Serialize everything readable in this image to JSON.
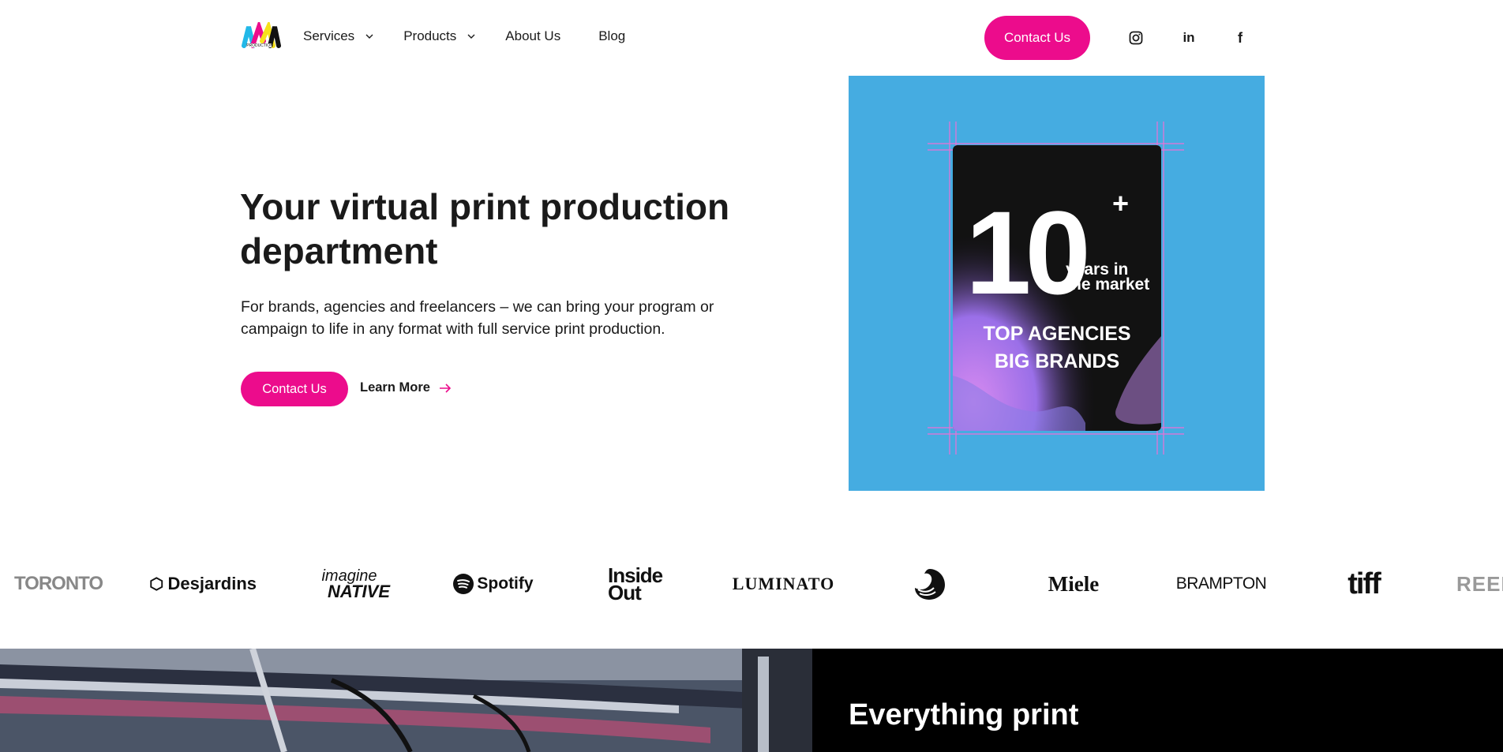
{
  "header": {
    "logo_alt": "M Production",
    "logo_caption": "PRODUCTION",
    "nav": [
      {
        "label": "Services",
        "has_dropdown": true
      },
      {
        "label": "Products",
        "has_dropdown": true
      },
      {
        "label": "About Us",
        "has_dropdown": false
      },
      {
        "label": "Blog",
        "has_dropdown": false
      }
    ],
    "cta_label": "Contact Us",
    "social": [
      {
        "icon": "instagram-icon"
      },
      {
        "icon": "linkedin-icon",
        "glyph": "in"
      },
      {
        "icon": "facebook-icon",
        "glyph": "f"
      }
    ]
  },
  "hero": {
    "title": "Your virtual print production department",
    "description": "For brands, agencies and freelancers – we can bring your program or campaign to life in any format with full service print production.",
    "primary_cta": "Contact Us",
    "secondary_cta": "Learn More"
  },
  "hero_visual": {
    "big_number": "10",
    "plus": "+",
    "years_text_line1": "years in",
    "years_text_line2": "the market",
    "tagline_line1": "TOP AGENCIES",
    "tagline_line2": "BIG BRANDS",
    "background_color": "#45ace1"
  },
  "brands": [
    {
      "name": "TORONTO"
    },
    {
      "name": "Desjardins"
    },
    {
      "name": "imagine",
      "line2": "NATIVE"
    },
    {
      "name": "Spotify"
    },
    {
      "name": "Inside",
      "line2": "Out"
    },
    {
      "name": "LUMINATO"
    },
    {
      "name": "swan-logo-icon"
    },
    {
      "name": "Miele"
    },
    {
      "name": "BRAMPTON"
    },
    {
      "name": "tiff"
    },
    {
      "name": "REEL C"
    }
  ],
  "section_two": {
    "title": "Everything print"
  },
  "colors": {
    "accent": "#ec0c8c",
    "text": "#1a1a1a",
    "dark_panel": "#000000"
  }
}
